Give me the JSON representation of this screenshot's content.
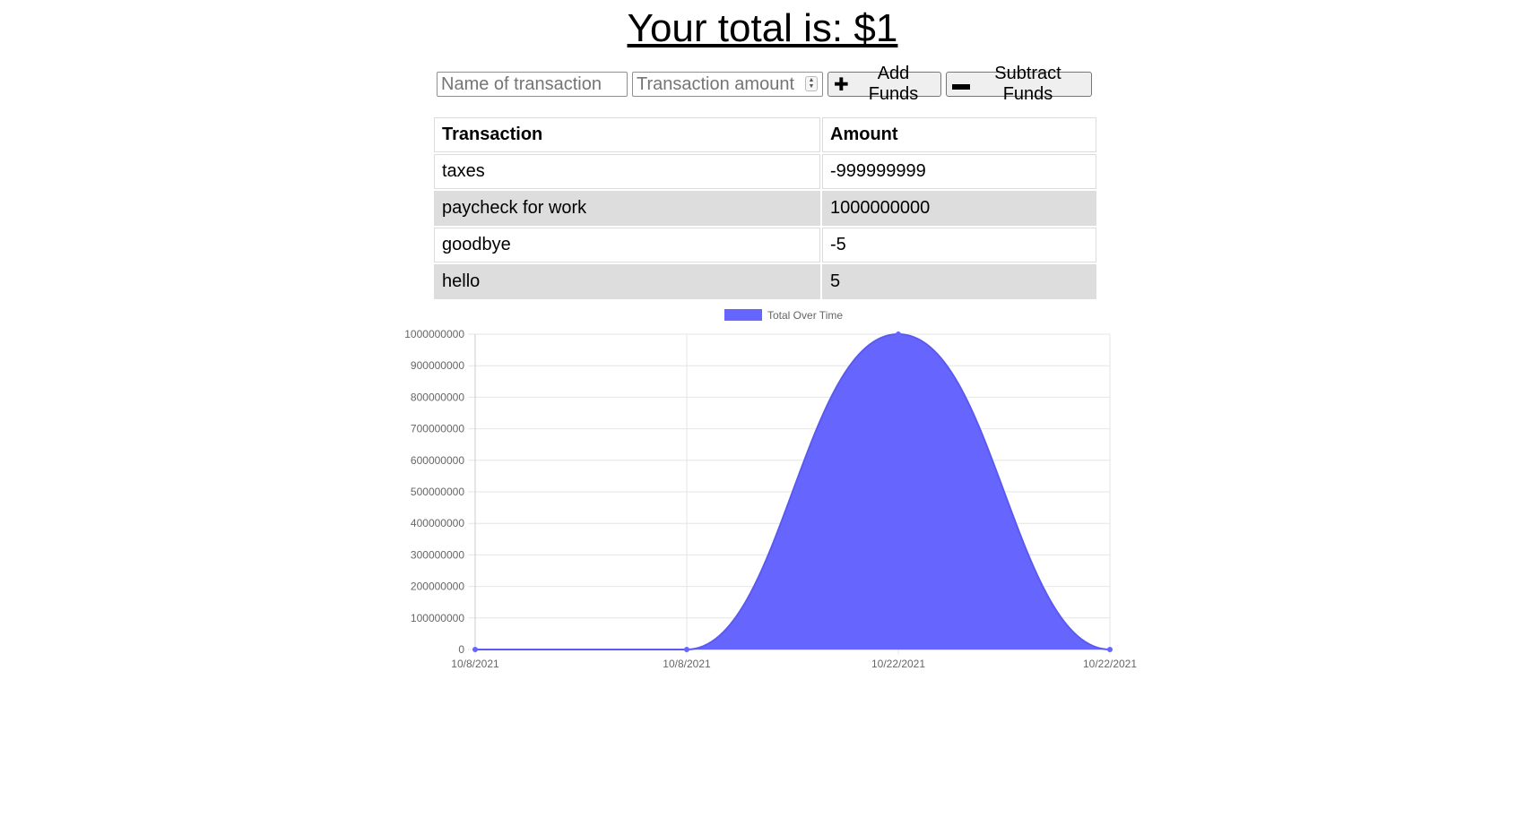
{
  "header": {
    "total_label": "Your total is: $",
    "total_value": "1"
  },
  "form": {
    "name_placeholder": "Name of transaction",
    "amount_placeholder": "Transaction amount",
    "add_label": "Add Funds",
    "add_icon": "plus-icon",
    "subtract_label": "Subtract Funds",
    "subtract_icon": "minus-icon"
  },
  "table": {
    "headers": [
      "Transaction",
      "Amount"
    ],
    "rows": [
      {
        "name": "taxes",
        "amount": "-999999999"
      },
      {
        "name": "paycheck for work",
        "amount": "1000000000"
      },
      {
        "name": "goodbye",
        "amount": "-5"
      },
      {
        "name": "hello",
        "amount": "5"
      }
    ]
  },
  "chart_data": {
    "type": "area",
    "x": [
      "10/8/2021",
      "10/8/2021",
      "10/22/2021",
      "10/22/2021"
    ],
    "series": [
      {
        "name": "Total Over Time",
        "values": [
          0,
          5,
          1000000000,
          1
        ],
        "color": "#6666ff"
      }
    ],
    "ylim": [
      0,
      1000000000
    ],
    "yticks": [
      0,
      100000000,
      200000000,
      300000000,
      400000000,
      500000000,
      600000000,
      700000000,
      800000000,
      900000000,
      1000000000
    ],
    "grid": true,
    "legend": "top-center"
  }
}
